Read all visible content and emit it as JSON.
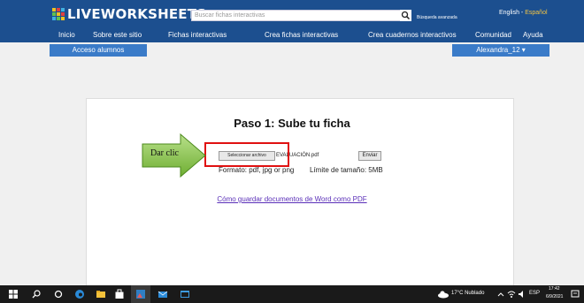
{
  "header": {
    "logo_text": "LIVEWORKSHEETS",
    "search_placeholder": "Buscar fichas interactivas",
    "advanced_search": "Búsqueda avanzada",
    "lang_en": "English",
    "lang_sep": "-",
    "lang_es": "Español"
  },
  "nav": {
    "items": [
      "Inicio",
      "Sobre este sitio",
      "Fichas interactivas",
      "Crea fichas interactivas",
      "Crea cuadernos interactivos",
      "Comunidad",
      "Ayuda"
    ]
  },
  "subbar": {
    "students": "Acceso alumnos",
    "user": "Alexandra_12 ▾"
  },
  "upload": {
    "title": "Paso 1: Sube tu ficha",
    "choose_file": "Seleccionar archivo",
    "file_name": "EVALUACIÓN.pdf",
    "send": "Enviar",
    "formats": "Formato: pdf, jpg or png",
    "limit": "Límite de tamaño: 5MB",
    "help_link": "Cómo guardar documentos de Word como PDF"
  },
  "annotation": {
    "label": "Dar clic"
  },
  "taskbar": {
    "weather": "17°C Nublado",
    "lang": "ESP",
    "time": "17:42",
    "date": "6/9/2021"
  },
  "colors": {
    "header_bg": "#1c4f8f",
    "subbar_bg": "#3a7bc8",
    "highlight": "#e01010",
    "arrow": "#86c341"
  }
}
